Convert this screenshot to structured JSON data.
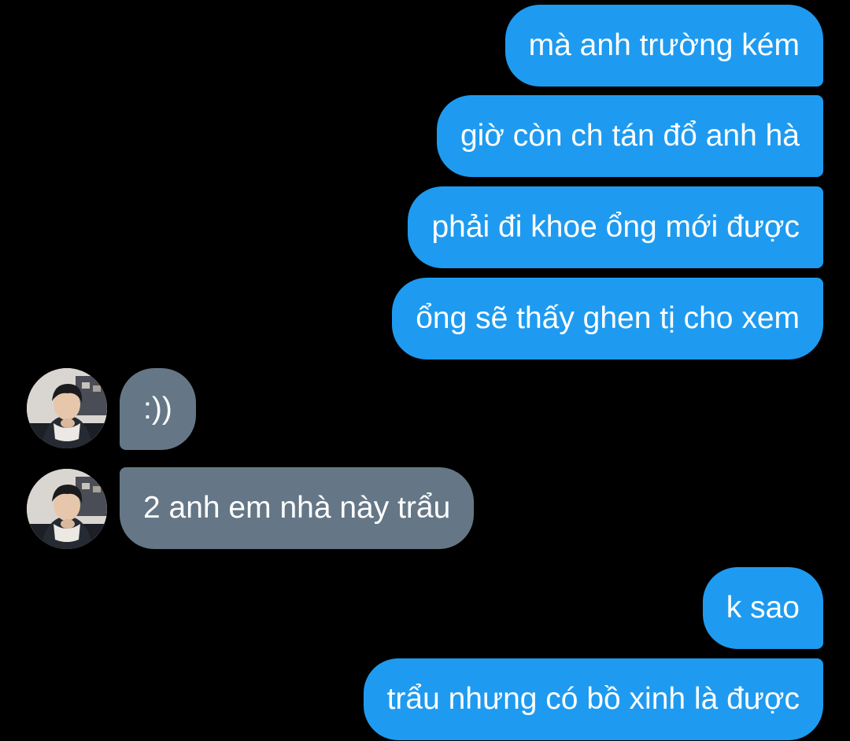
{
  "messages": [
    {
      "text": "mà anh trường kém",
      "sender": "me"
    },
    {
      "text": "giờ còn ch tán đổ anh hà",
      "sender": "me"
    },
    {
      "text": "phải đi khoe ổng mới được",
      "sender": "me"
    },
    {
      "text": "ổng sẽ thấy ghen tị cho xem",
      "sender": "me"
    },
    {
      "text": ":))",
      "sender": "other"
    },
    {
      "text": "2 anh em nhà này trẩu",
      "sender": "other"
    },
    {
      "text": "k sao",
      "sender": "me"
    },
    {
      "text": "trẩu nhưng có bồ xinh là được",
      "sender": "me"
    }
  ],
  "colors": {
    "background": "#000000",
    "outgoing_bubble": "#1e9bf0",
    "incoming_bubble": "#657786",
    "text": "#ffffff"
  },
  "icons": {
    "avatar": "user-avatar-photo"
  }
}
